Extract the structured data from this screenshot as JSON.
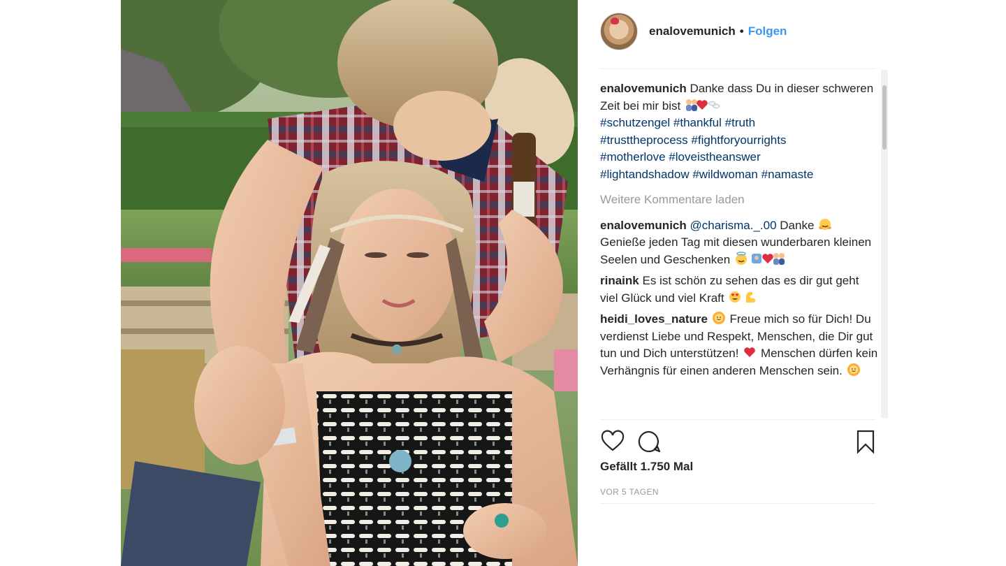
{
  "post": {
    "username": "enalovemunich",
    "follow_label": "Folgen",
    "likes_text": "Gefällt 1.750 Mal",
    "time_ago": "VOR 5 TAGEN",
    "load_more_label": "Weitere Kommentare laden"
  },
  "caption": {
    "user": "enalovemunich",
    "text": "Danke dass Du in dieser schweren Zeit bei mir bist",
    "emojis": [
      "couple-emoji",
      "red-heart-emoji",
      "angel-wings-emoji"
    ],
    "hashtags": [
      "#schutzengel",
      "#thankful",
      "#truth",
      "#trusttheprocess",
      "#fightforyourrights",
      "#motherlove",
      "#loveistheanswer",
      "#lightandshadow",
      "#wildwoman",
      "#namaste"
    ]
  },
  "comments": [
    {
      "user": "enalovemunich",
      "mention": "@charisma._.00",
      "text_1": "Danke",
      "text_2": "Genieße jeden Tag mit diesen wunderbaren kleinen Seelen und Geschenken"
    },
    {
      "user": "rinaink",
      "text": "Es ist schön zu sehen das es dir gut geht viel Glück und viel Kraft"
    },
    {
      "user": "heidi_loves_nature",
      "text_1": "Freue mich so für Dich! Du verdienst Liebe und Respekt, Menschen, die Dir gut tun und Dich unterstützen!",
      "text_2": "Menschen dürfen kein Verhängnis für einen anderen Menschen sein."
    }
  ],
  "icons": [
    "heart-icon",
    "comment-icon",
    "bookmark-icon"
  ],
  "colors": {
    "link_blue": "#3897f0",
    "hashtag_blue": "#003569",
    "muted_gray": "#999999",
    "text": "#262626"
  }
}
